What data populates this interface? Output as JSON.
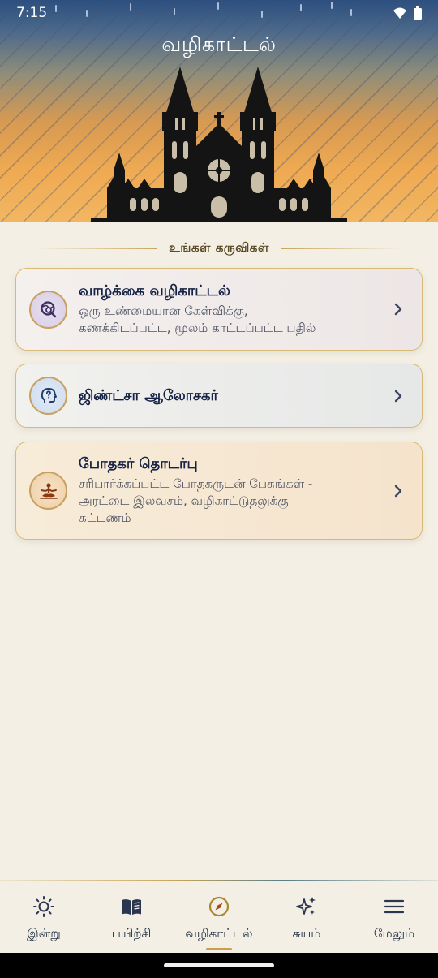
{
  "status_bar": {
    "time": "7:15",
    "icons": [
      "wifi-icon",
      "battery-icon"
    ]
  },
  "header": {
    "title": "வழிகாட்டல்",
    "image": "cathedral-illustration"
  },
  "section": {
    "heading": "உங்கள் கருவிகள்"
  },
  "cards": [
    {
      "title": "வாழ்க்கை வழிகாட்டல்",
      "subtitle_line1": "ஒரு உண்மையான கேள்விக்கு,",
      "subtitle_line2": "கணக்கிடப்பட்ட, மூலம் காட்டப்பட்ட பதில்",
      "icon": "search-globe-icon",
      "accent": "#d8cfe6"
    },
    {
      "title": "ஜிண்ட்சா ஆலோசகர்",
      "icon": "head-question-icon",
      "accent": "#cddcee"
    },
    {
      "title": "போதகர் தொடர்பு",
      "subtitle_line1": "சரிபார்க்கப்பட்ட போதகருடன் பேசுங்கள் -",
      "subtitle_line2": "அரட்டை இலவசம், வழிகாட்டுதலுக்கு",
      "subtitle_line3": "கட்டணம்",
      "icon": "meditation-icon",
      "accent": "#efcfa6"
    }
  ],
  "nav": {
    "items": [
      {
        "label": "இன்று",
        "icon": "sun-icon"
      },
      {
        "label": "பயிற்சி",
        "icon": "book-icon"
      },
      {
        "label": "வழிகாட்டல்",
        "icon": "compass-icon",
        "active": true
      },
      {
        "label": "சுயம்",
        "icon": "sparkles-icon"
      },
      {
        "label": "மேலும்",
        "icon": "menu-icon"
      }
    ]
  },
  "colors": {
    "background": "#f3efe4",
    "gold_accent": "#c9a55a",
    "title_text": "#152244"
  }
}
